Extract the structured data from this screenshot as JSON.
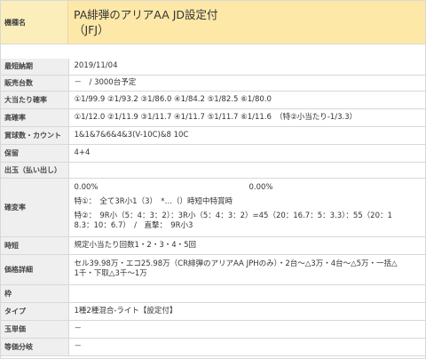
{
  "header": {
    "key": "機種名",
    "title_line1": "PA緋弾のアリアAA JD設定付",
    "title_line2": "（JFJ）"
  },
  "rows": {
    "release": {
      "key": "最短納期",
      "value": "2019/11/04"
    },
    "units": {
      "key": "販売台数",
      "value": "－　/ 3000台予定"
    },
    "jackpot": {
      "key": "大当たり確率",
      "value": "①1/99.9 ②1/93.2 ③1/86.0 ④1/84.2 ⑤1/82.5 ⑥1/80.0"
    },
    "highprob": {
      "key": "高確率",
      "value": "①1/12.0 ②1/11.9 ③1/11.7 ④1/11.7 ⑤1/11.7 ⑥1/11.6　（特②小当たり-1/3.3）"
    },
    "balls": {
      "key": "賞球数・カウント",
      "value": "1&1&7&6&4&3(V-10C)&8 10C"
    },
    "hold": {
      "key": "保留",
      "value": "4+4"
    },
    "payout": {
      "key": "出玉（払い出し）",
      "value": ""
    },
    "kakuhen": {
      "key": "確変率",
      "pct_a": "0.00%",
      "pct_b": "0.00%",
      "special1": "特①：　全て3R小1（3）　*…（）時短中特賞時",
      "special2a": "特②：　9R小（5：4：3：2）：3R小（5：4：3：2）=45（20：16.7：5：3.3）：55（20：1",
      "special2b": "8.3：10：6.7）　/　直撃：　9R小3"
    },
    "jitan": {
      "key": "時短",
      "value": "規定小当たり回数1・2・3・4・5回"
    },
    "price": {
      "key": "価格詳細",
      "line1": "セル39.98万・エコ25.98万（CR緋弾のアリアAA JPHのみ）・2台～△3万・4台～△5万・一括△",
      "line2": "1千・下取△3千～1万"
    },
    "frame": {
      "key": "枠",
      "value": ""
    },
    "type": {
      "key": "タイプ",
      "value": "1種2種混合-ライト【設定付】"
    },
    "unit_price": {
      "key": "玉単価",
      "value": "－"
    },
    "rank": {
      "key": "等価分岐",
      "value": "－"
    }
  },
  "colors": {
    "header_bg": "#fde8a8",
    "key_bg": "#efefef",
    "price_text": "#b03030"
  }
}
